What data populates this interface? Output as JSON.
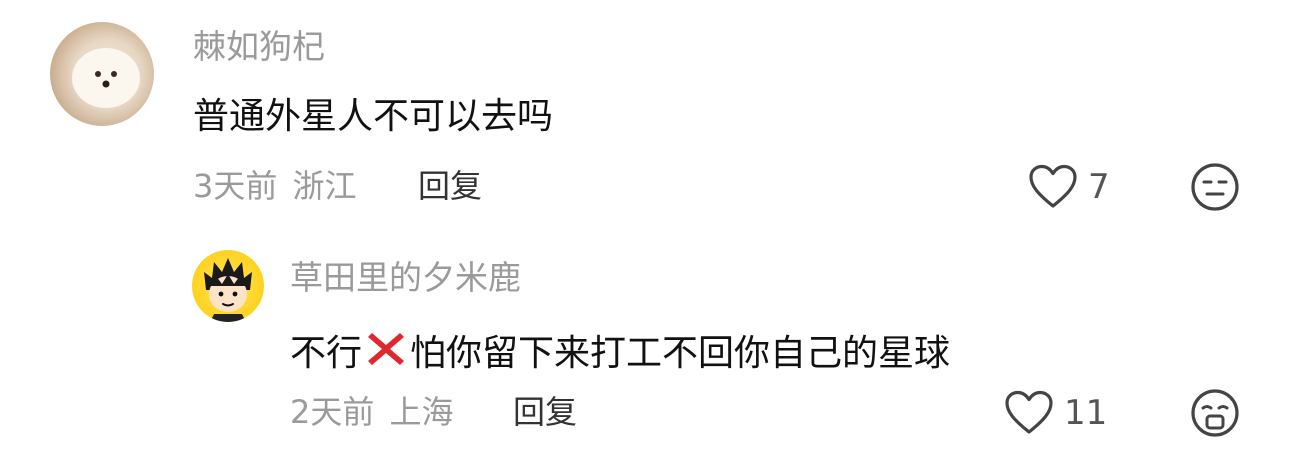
{
  "comments": [
    {
      "username": "棘如狗杞",
      "text": "普通外星人不可以去吗",
      "time": "3天前",
      "location": "浙江",
      "reply_label": "回复",
      "likes": "7",
      "avatar_icon": "fluffy-dog-avatar",
      "like_icon": "heart-outline-icon",
      "reaction_icon": "neutral-face-icon",
      "replies": [
        {
          "username": "草田里的夕米鹿",
          "text_before": "不行",
          "emoji_icon": "red-cross-mark-icon",
          "text_after": "怕你留下来打工不回你自己的星球",
          "time": "2天前",
          "location": "上海",
          "reply_label": "回复",
          "likes": "11",
          "avatar_icon": "cartoon-boy-avatar",
          "like_icon": "heart-outline-icon",
          "reaction_icon": "crying-face-icon"
        }
      ]
    }
  ],
  "colors": {
    "username": "#9a9a9a",
    "text": "#111111",
    "meta": "#9a9a9a",
    "reply": "#333333",
    "avatar_yellow": "#ffd21f",
    "cross_red": "#e0262f"
  }
}
